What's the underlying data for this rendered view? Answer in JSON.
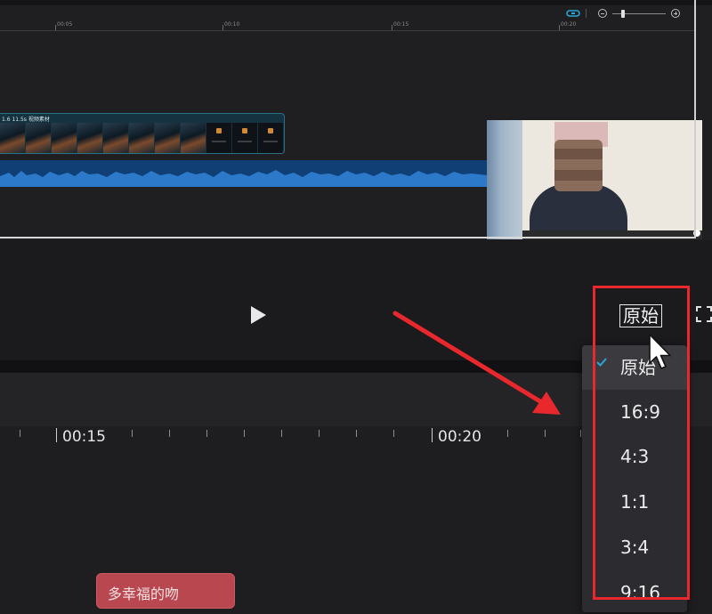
{
  "timeline_top": {
    "clip_label": "1.6  11.5s  视频素材",
    "mini_ruler_labels": [
      "00:05",
      "00:10",
      "00:15",
      "00:20"
    ]
  },
  "player": {
    "aspect_ratio_label": "原始"
  },
  "aspect_ratio_menu": {
    "selected": "原始",
    "options": [
      "原始",
      "16:9",
      "4:3",
      "1:1",
      "3:4",
      "9:16"
    ]
  },
  "timeline": {
    "ruler_labels": [
      "00:15",
      "00:20"
    ]
  },
  "subtitle_clip": {
    "text": "多幸福的吻"
  },
  "colors": {
    "annotation_red": "#e8282c",
    "audio_blue": "#0f3f75",
    "subtitle_clip": "#b9474f",
    "accent_cyan": "#2aa7d8"
  }
}
